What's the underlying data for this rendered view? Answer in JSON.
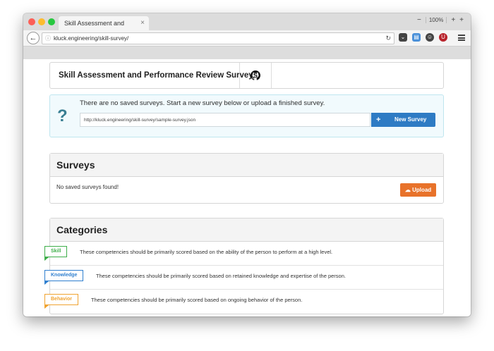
{
  "browser": {
    "tab_title": "Skill Assessment and Performa...",
    "tab_close": "×",
    "url": "kluck.engineering/skill-survey/",
    "zoom": "100%",
    "minus": "−",
    "plus": "+",
    "newtab": "+"
  },
  "header": {
    "title": "Skill Assessment and Performance Review Surveys"
  },
  "alert": {
    "icon": "?",
    "message": "There are no saved surveys. Start a new survey below or upload a finished survey.",
    "input_value": "http://kluck.engineering/skill-survey/sample-survey.json",
    "button_icon": "+",
    "button_label": "New Survey"
  },
  "surveys": {
    "title": "Surveys",
    "empty_text": "No saved surveys found!",
    "upload_label": "Upload"
  },
  "categories": {
    "title": "Categories",
    "items": [
      {
        "name": "Skill",
        "color": "#3dae49",
        "description": "These competencies should be primarily scored based on the ability of the person to perform at a high level."
      },
      {
        "name": "Knowledge",
        "color": "#2f7fcf",
        "description": "These competencies should be primarily scored based on retained knowledge and expertise of the person."
      },
      {
        "name": "Behavior",
        "color": "#f0a330",
        "description": "These competencies should be primarily scored based on ongoing behavior of the person."
      }
    ]
  },
  "colors": {
    "accent_blue": "#2e7bc4",
    "upload_orange": "#e8722a"
  }
}
